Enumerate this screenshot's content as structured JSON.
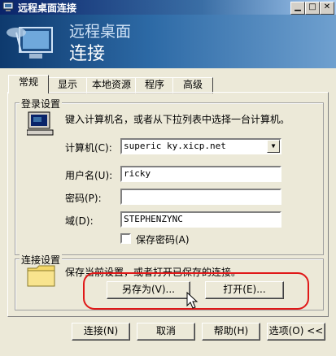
{
  "window": {
    "title": "远程桌面连接"
  },
  "banner": {
    "line1": "远程桌面",
    "line2": "连接"
  },
  "tabs": [
    "常规",
    "显示",
    "本地资源",
    "程序",
    "高级"
  ],
  "login_group": {
    "title": "登录设置",
    "instruction": "键入计算机名，或者从下拉列表中选择一台计算机。",
    "computer_label": "计算机(C):",
    "computer_value": "superic ky.xicp.net",
    "username_label": "用户名(U):",
    "username_value": "ricky",
    "password_label": "密码(P):",
    "password_value": "",
    "domain_label": "域(D):",
    "domain_value": "STEPHENZYNC",
    "save_password_label": "保存密码(A)"
  },
  "connection_group": {
    "title": "连接设置",
    "text": "保存当前设置，或者打开已保存的连接。",
    "save_as_label": "另存为(V)...",
    "open_label": "打开(E)..."
  },
  "footer": {
    "connect_label": "连接(N)",
    "cancel_label": "取消",
    "help_label": "帮助(H)",
    "options_label": "选项(O) <<"
  }
}
